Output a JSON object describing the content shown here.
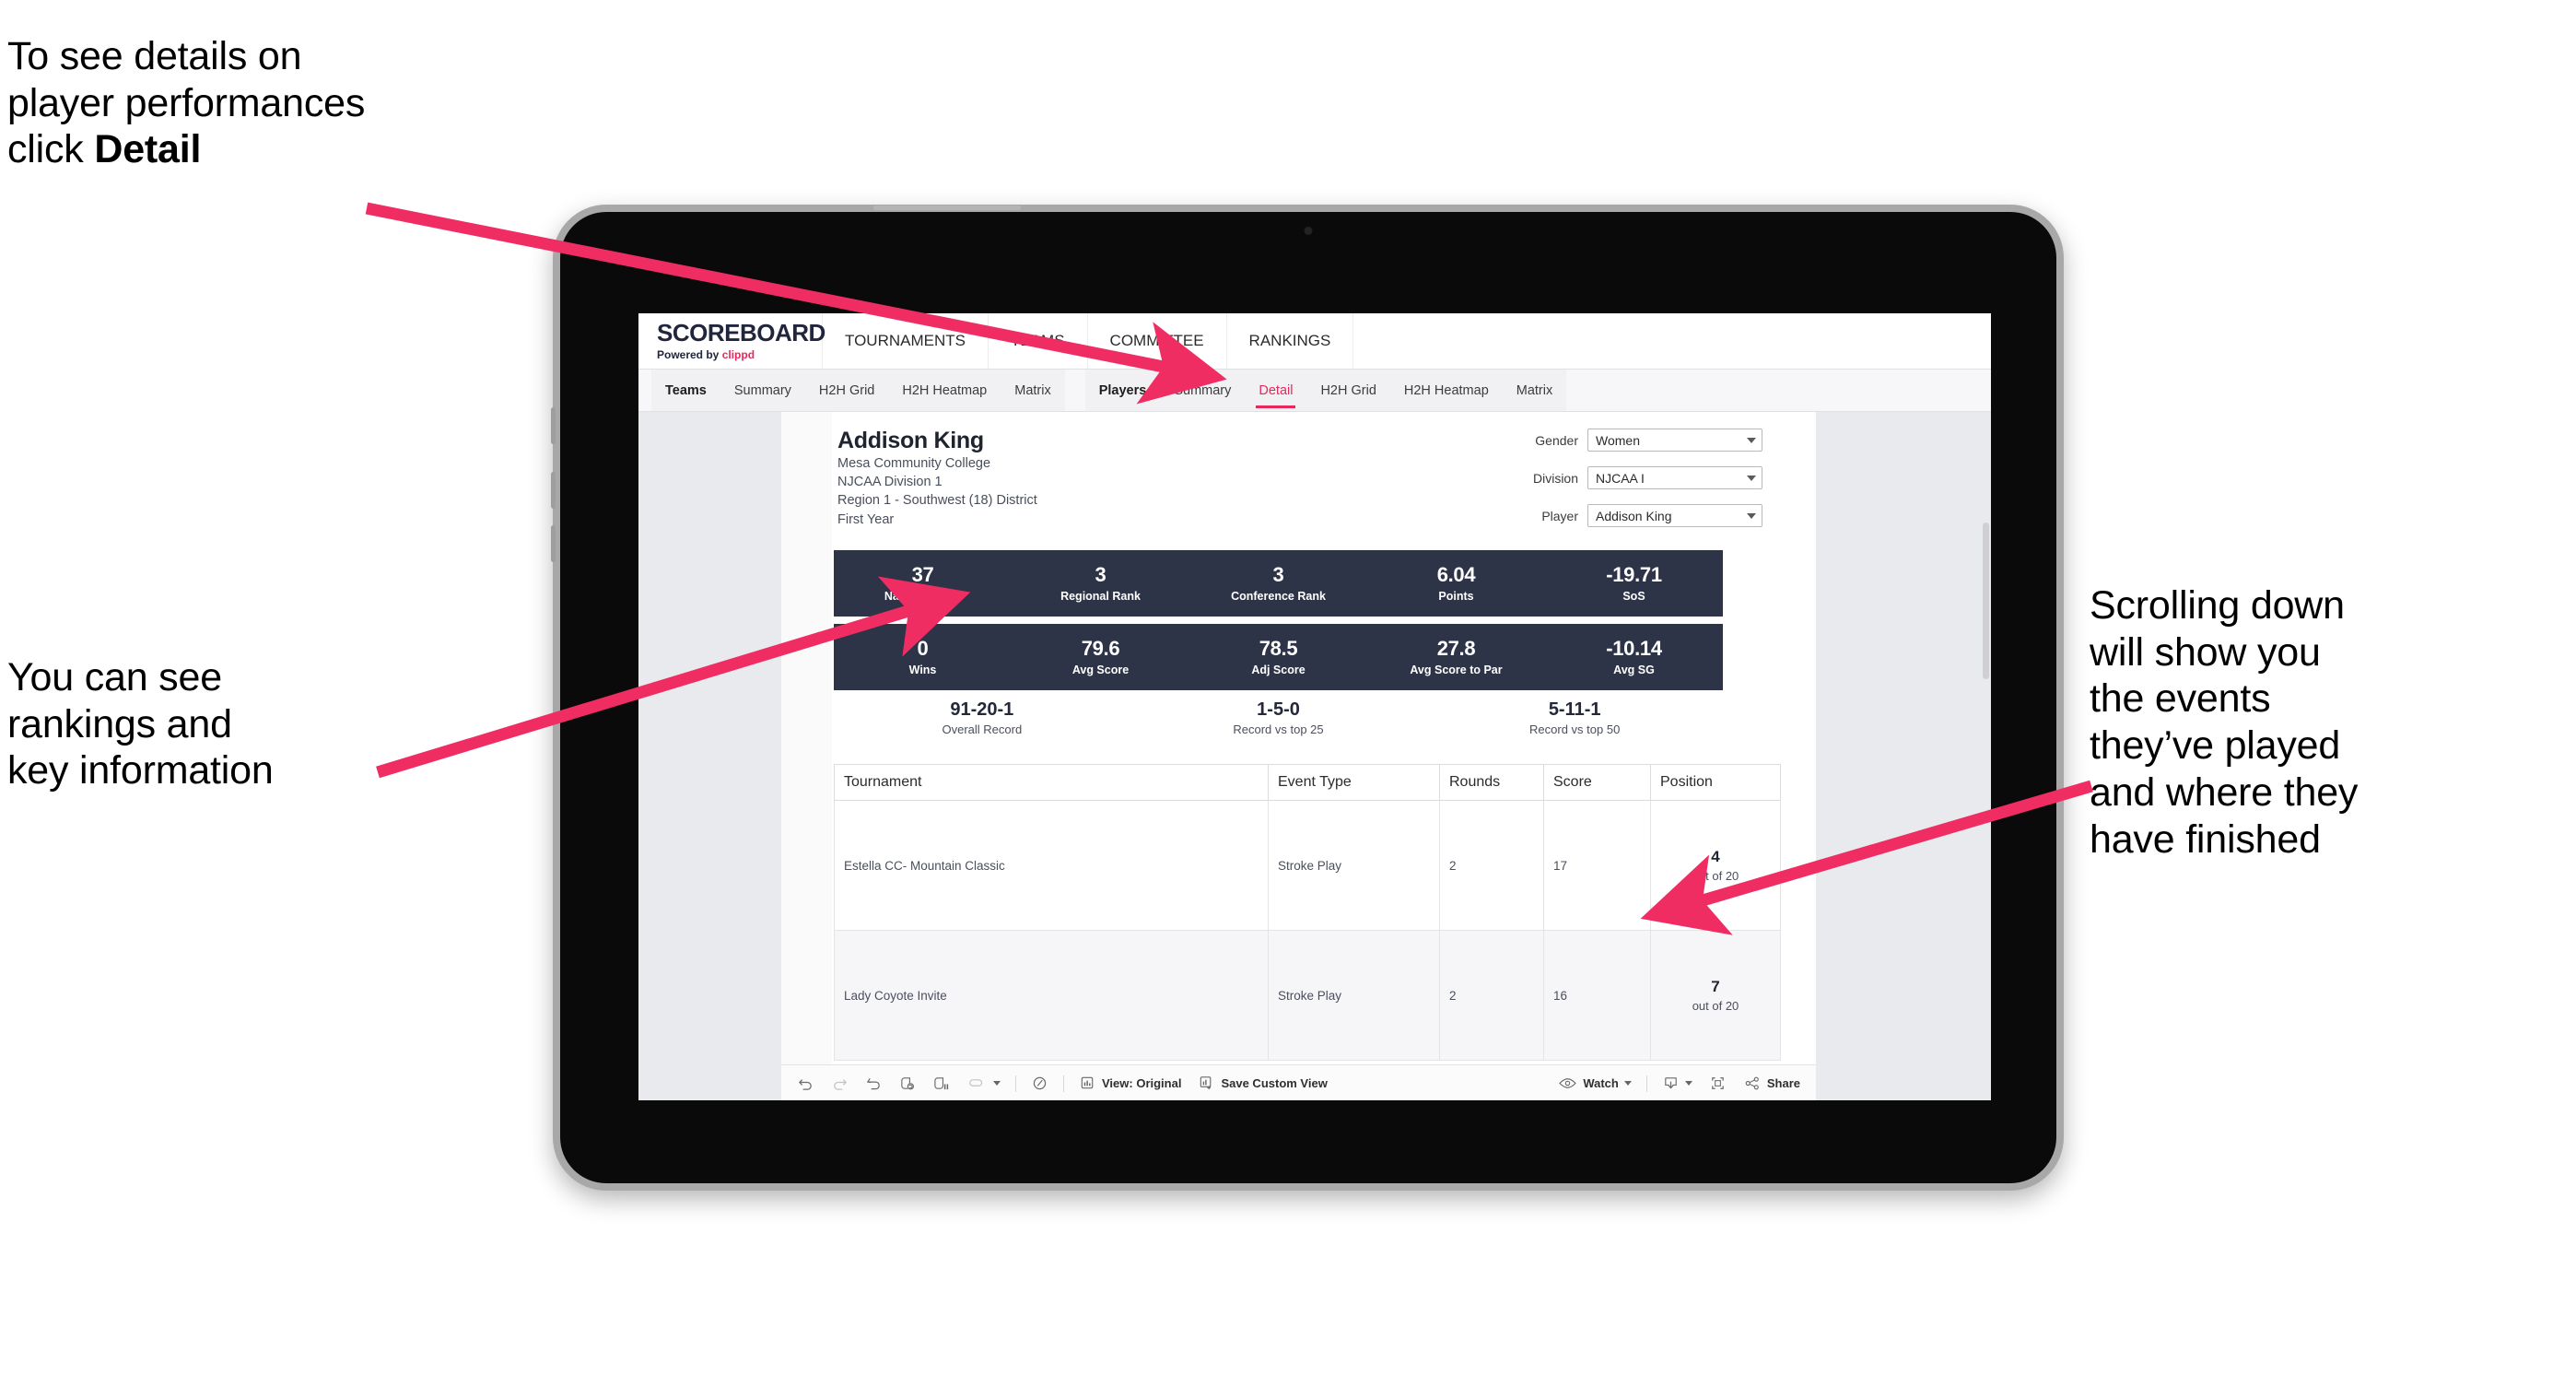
{
  "annotations": {
    "top": {
      "line1": "To see details on",
      "line2": "player performances",
      "line3_prefix": "click ",
      "line3_bold": "Detail"
    },
    "left": {
      "line1": "You can see",
      "line2": "rankings and",
      "line3": "key information"
    },
    "right": {
      "line1": "Scrolling down",
      "line2": "will show you",
      "line3": "the events",
      "line4": "they’ve played",
      "line5": "and where they",
      "line6": "have finished"
    }
  },
  "colors": {
    "accent_pink": "#e8285c",
    "band_navy": "#2e3448",
    "page_bg": "#ffffff",
    "screen_bg": "#e8eaed"
  },
  "app": {
    "brand": {
      "name": "SCOREBOARD",
      "powered_prefix": "Powered by ",
      "powered_brand": "clippd"
    },
    "topnav": [
      {
        "label": "TOURNAMENTS"
      },
      {
        "label": "TEAMS"
      },
      {
        "label": "COMMITTEE"
      },
      {
        "label": "RANKINGS"
      }
    ],
    "subnav": {
      "group_teams": [
        {
          "label": "Teams",
          "lead": true,
          "active": false
        },
        {
          "label": "Summary",
          "lead": false,
          "active": false
        },
        {
          "label": "H2H Grid",
          "lead": false,
          "active": false
        },
        {
          "label": "H2H Heatmap",
          "lead": false,
          "active": false
        },
        {
          "label": "Matrix",
          "lead": false,
          "active": false
        }
      ],
      "group_players": [
        {
          "label": "Players",
          "lead": true,
          "active": false
        },
        {
          "label": "Summary",
          "lead": false,
          "active": false
        },
        {
          "label": "Detail",
          "lead": false,
          "active": true
        },
        {
          "label": "H2H Grid",
          "lead": false,
          "active": false
        },
        {
          "label": "H2H Heatmap",
          "lead": false,
          "active": false
        },
        {
          "label": "Matrix",
          "lead": false,
          "active": false
        }
      ]
    },
    "player": {
      "name": "Addison King",
      "school": "Mesa Community College",
      "division": "NJCAA Division 1",
      "region": "Region 1 - Southwest (18) District",
      "year": "First Year"
    },
    "filters": [
      {
        "label": "Gender",
        "value": "Women"
      },
      {
        "label": "Division",
        "value": "NJCAA I"
      },
      {
        "label": "Player",
        "value": "Addison King"
      }
    ],
    "stats_band_1": [
      {
        "value": "37",
        "label": "National Rank"
      },
      {
        "value": "3",
        "label": "Regional Rank"
      },
      {
        "value": "3",
        "label": "Conference Rank"
      },
      {
        "value": "6.04",
        "label": "Points"
      },
      {
        "value": "-19.71",
        "label": "SoS"
      }
    ],
    "stats_band_2": [
      {
        "value": "0",
        "label": "Wins"
      },
      {
        "value": "79.6",
        "label": "Avg Score"
      },
      {
        "value": "78.5",
        "label": "Adj Score"
      },
      {
        "value": "27.8",
        "label": "Avg Score to Par"
      },
      {
        "value": "-10.14",
        "label": "Avg SG"
      }
    ],
    "records": [
      {
        "value": "91-20-1",
        "label": "Overall Record"
      },
      {
        "value": "1-5-0",
        "label": "Record vs top 25"
      },
      {
        "value": "5-11-1",
        "label": "Record vs top 50"
      }
    ],
    "table": {
      "headers": [
        "Tournament",
        "Event Type",
        "Rounds",
        "Score",
        "Position"
      ],
      "rows": [
        {
          "tournament": "Estella CC- Mountain Classic",
          "event_type": "Stroke Play",
          "rounds": "2",
          "score": "17",
          "position_value": "4",
          "position_label": "out of 20"
        },
        {
          "tournament": "Lady Coyote Invite",
          "event_type": "Stroke Play",
          "rounds": "2",
          "score": "16",
          "position_value": "7",
          "position_label": "out of 20"
        }
      ]
    },
    "toolbar": {
      "undo": "undo-icon",
      "redo": "redo-icon",
      "revert": "revert-icon",
      "refresh": "refresh-data-icon",
      "pause": "pause-auto-update-icon",
      "highlight": "highlight-icon",
      "clock": "request-data-icon",
      "view_label": "View: Original",
      "save_label": "Save Custom View",
      "watch_label": "Watch",
      "download": "download-icon",
      "fullscreen": "fullscreen-icon",
      "share_label": "Share"
    }
  }
}
